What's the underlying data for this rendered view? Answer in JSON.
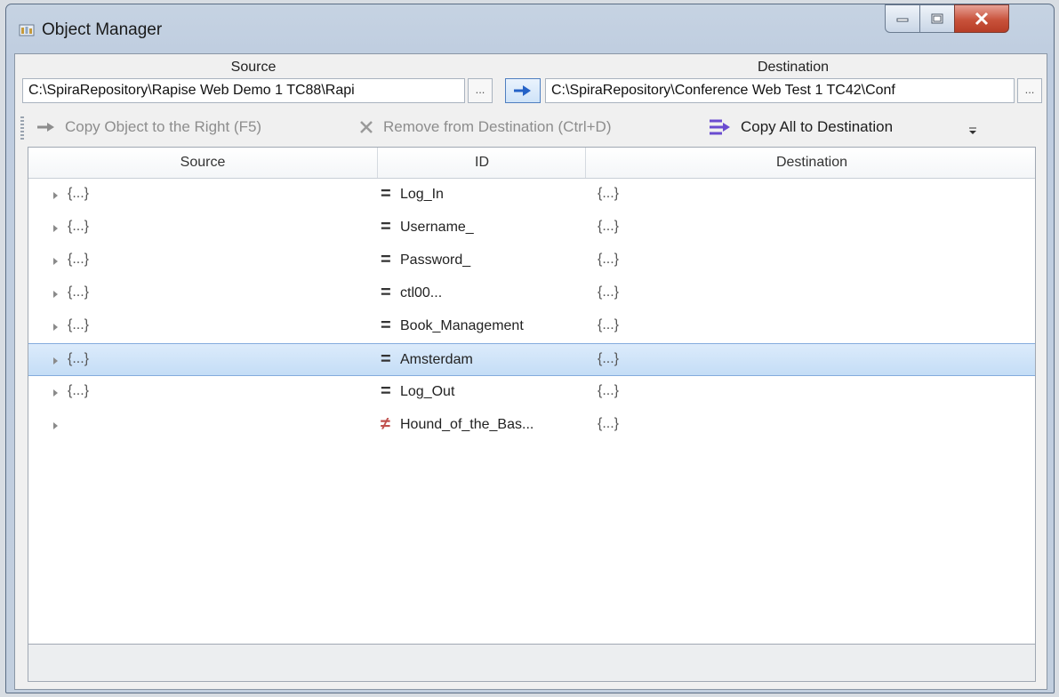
{
  "window": {
    "title": "Object Manager",
    "accent_color": "#3b7ddb",
    "close_color": "#c8523b"
  },
  "paths": {
    "source_label": "Source",
    "source_value": "C:\\SpiraRepository\\Rapise Web Demo 1 TC88\\Rapi",
    "destination_label": "Destination",
    "destination_value": "C:\\SpiraRepository\\Conference Web Test 1 TC42\\Conf",
    "browse_label": "..."
  },
  "toolbar": {
    "copy_right": "Copy Object to the Right (F5)",
    "remove": "Remove from Destination (Ctrl+D)",
    "copy_all": "Copy All to Destination"
  },
  "grid": {
    "columns": [
      "Source",
      "ID",
      "Destination"
    ],
    "rows": [
      {
        "source": "{...}",
        "match": "=",
        "id": "Log_In",
        "destination": "{...}",
        "selected": false
      },
      {
        "source": "{...}",
        "match": "=",
        "id": "Username_",
        "destination": "{...}",
        "selected": false
      },
      {
        "source": "{...}",
        "match": "=",
        "id": "Password_",
        "destination": "{...}",
        "selected": false
      },
      {
        "source": "{...}",
        "match": "=",
        "id": "ctl00...",
        "destination": "{...}",
        "selected": false
      },
      {
        "source": "{...}",
        "match": "=",
        "id": "Book_Management",
        "destination": "{...}",
        "selected": false
      },
      {
        "source": "{...}",
        "match": "=",
        "id": "Amsterdam",
        "destination": "{...}",
        "selected": true
      },
      {
        "source": "{...}",
        "match": "=",
        "id": "Log_Out",
        "destination": "{...}",
        "selected": false
      },
      {
        "source": "",
        "match": "≠",
        "id": "Hound_of_the_Bas...",
        "destination": "{...}",
        "selected": false
      }
    ]
  }
}
